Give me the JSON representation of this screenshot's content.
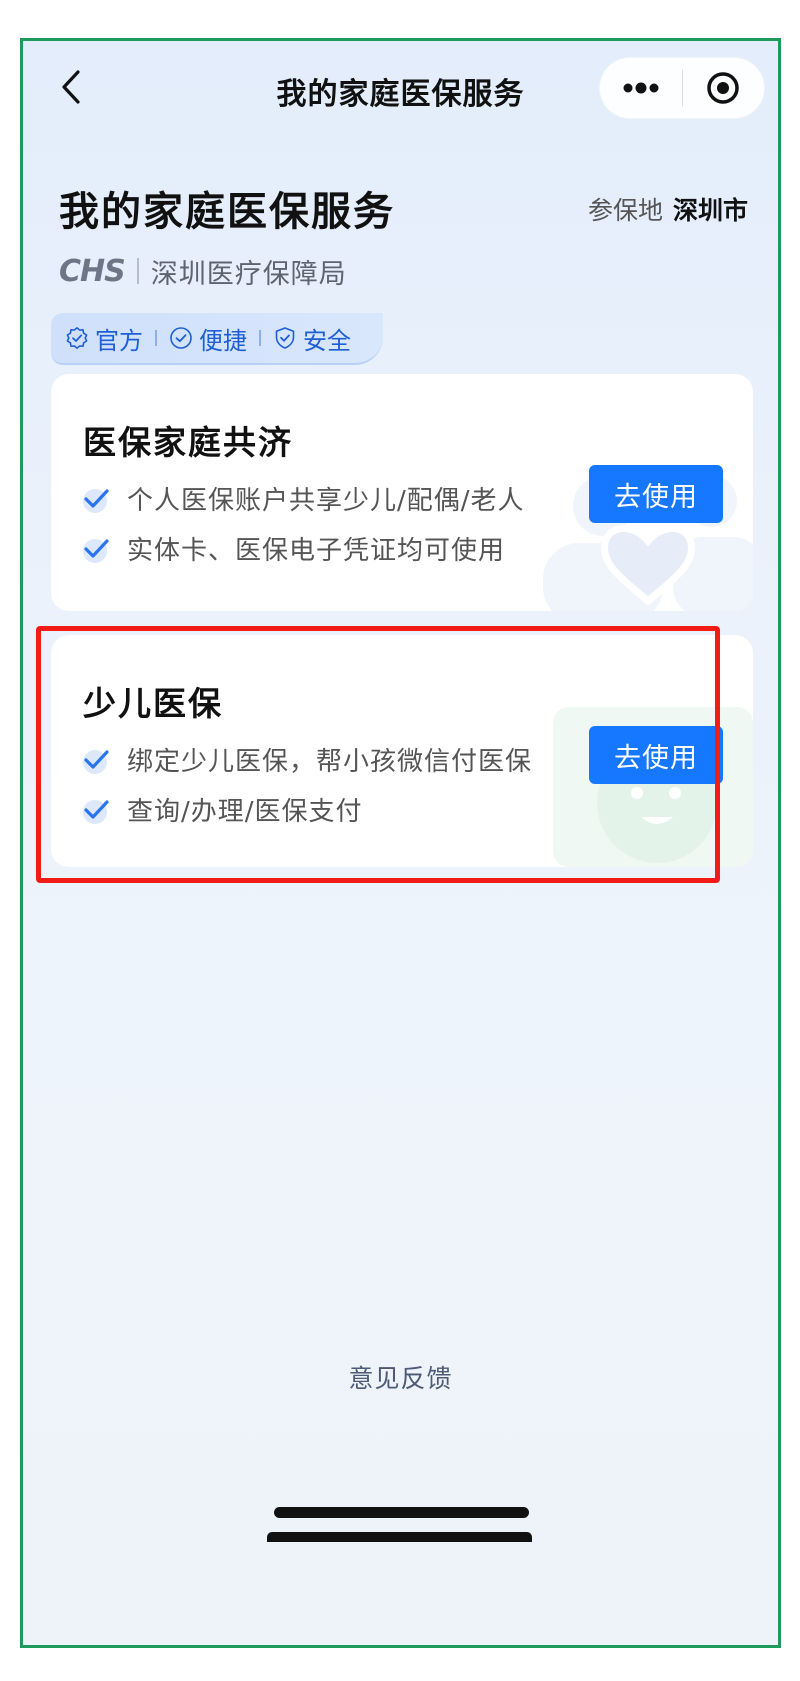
{
  "nav": {
    "title": "我的家庭医保服务"
  },
  "header": {
    "title": "我的家庭医保服务",
    "region_label": "参保地",
    "region_value": "深圳市",
    "org_logo": "CHS",
    "org_name": "深圳医疗保障局",
    "badges": [
      "官方",
      "便捷",
      "安全"
    ]
  },
  "cards": [
    {
      "title": "医保家庭共济",
      "features": [
        "个人医保账户共享少儿/配偶/老人",
        "实体卡、医保电子凭证均可使用"
      ],
      "button": "去使用",
      "decoration": "family-heart-icon"
    },
    {
      "title": "少儿医保",
      "features": [
        "绑定少儿医保，帮小孩微信付医保",
        "查询/办理/医保支付"
      ],
      "button": "去使用",
      "decoration": "child-face-icon"
    }
  ],
  "footer": {
    "feedback": "意见反馈"
  },
  "colors": {
    "accent": "#1677ff",
    "frame": "#1e9a5a",
    "highlight": "#f21c16"
  }
}
